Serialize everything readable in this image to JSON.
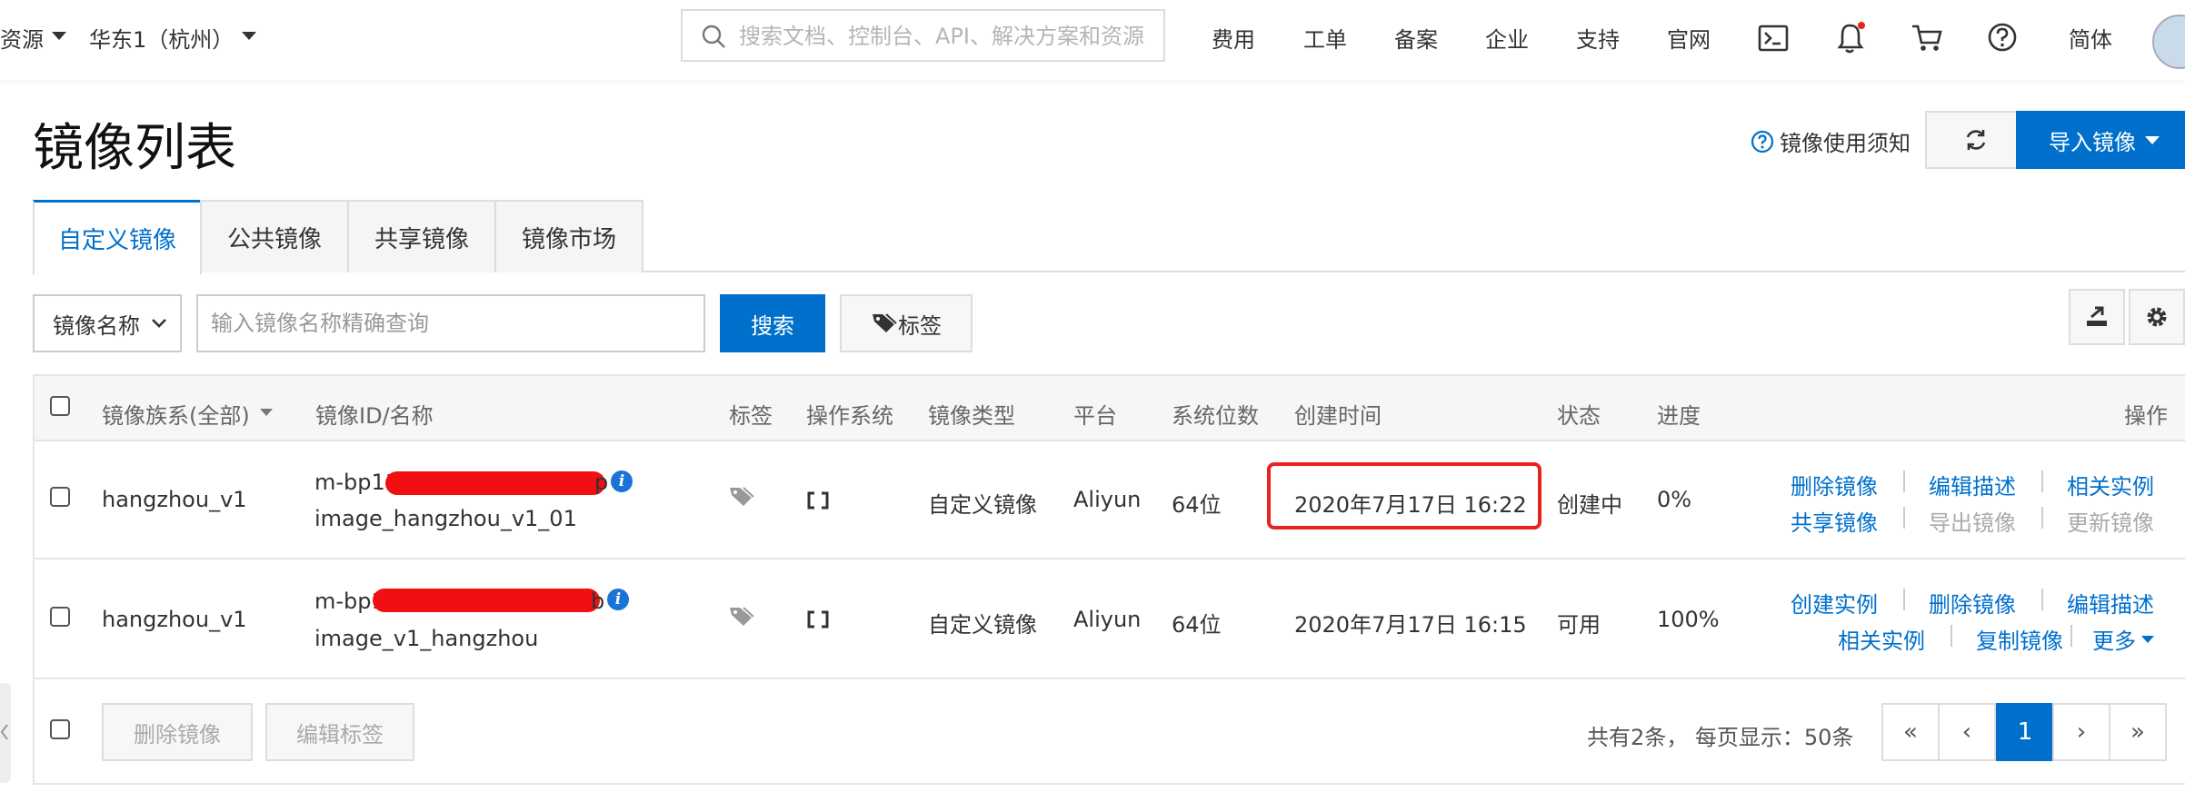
{
  "topbar": {
    "resources": "资源",
    "region": "华东1（杭州）",
    "search_placeholder": "搜索文档、控制台、API、解决方案和资源",
    "nav": [
      "费用",
      "工单",
      "备案",
      "企业",
      "支持",
      "官网"
    ],
    "lang": "简体"
  },
  "page": {
    "title": "镜像列表",
    "notice": "镜像使用须知",
    "import_label": "导入镜像"
  },
  "tabs": [
    "自定义镜像",
    "公共镜像",
    "共享镜像",
    "镜像市场"
  ],
  "filter": {
    "select_value": "镜像名称",
    "input_placeholder": "输入镜像名称精确查询",
    "search_label": "搜索",
    "tag_label": "标签"
  },
  "table": {
    "headers": [
      "镜像族系(全部)",
      "镜像ID/名称",
      "标签",
      "操作系统",
      "镜像类型",
      "平台",
      "系统位数",
      "创建时间",
      "状态",
      "进度",
      "操作"
    ],
    "rows": [
      {
        "family": "hangzhou_v1",
        "id_prefix": "m-bp11",
        "id_suffix": "p",
        "name": "image_hangzhou_v1_01",
        "type": "自定义镜像",
        "platform": "Aliyun",
        "bits": "64位",
        "created": "2020年7月17日 16:22",
        "status": "创建中",
        "progress": "0%",
        "actions": [
          "删除镜像",
          "编辑描述",
          "相关实例",
          "共享镜像",
          "导出镜像",
          "更新镜像"
        ]
      },
      {
        "family": "hangzhou_v1",
        "id_prefix": "m-bp1",
        "id_suffix": "b",
        "name": "image_v1_hangzhou",
        "type": "自定义镜像",
        "platform": "Aliyun",
        "bits": "64位",
        "created": "2020年7月17日 16:15",
        "status": "可用",
        "progress": "100%",
        "actions": [
          "创建实例",
          "删除镜像",
          "编辑描述",
          "相关实例",
          "复制镜像",
          "更多"
        ]
      }
    ]
  },
  "footer": {
    "delete_label": "删除镜像",
    "edit_tags_label": "编辑标签",
    "summary": "共有2条， 每页显示：50条",
    "pager": [
      "«",
      "‹",
      "1",
      "›",
      "»"
    ]
  },
  "colors": {
    "primary": "#0070cc",
    "highlight": "#e8231f",
    "redaction": "#f20f12"
  }
}
